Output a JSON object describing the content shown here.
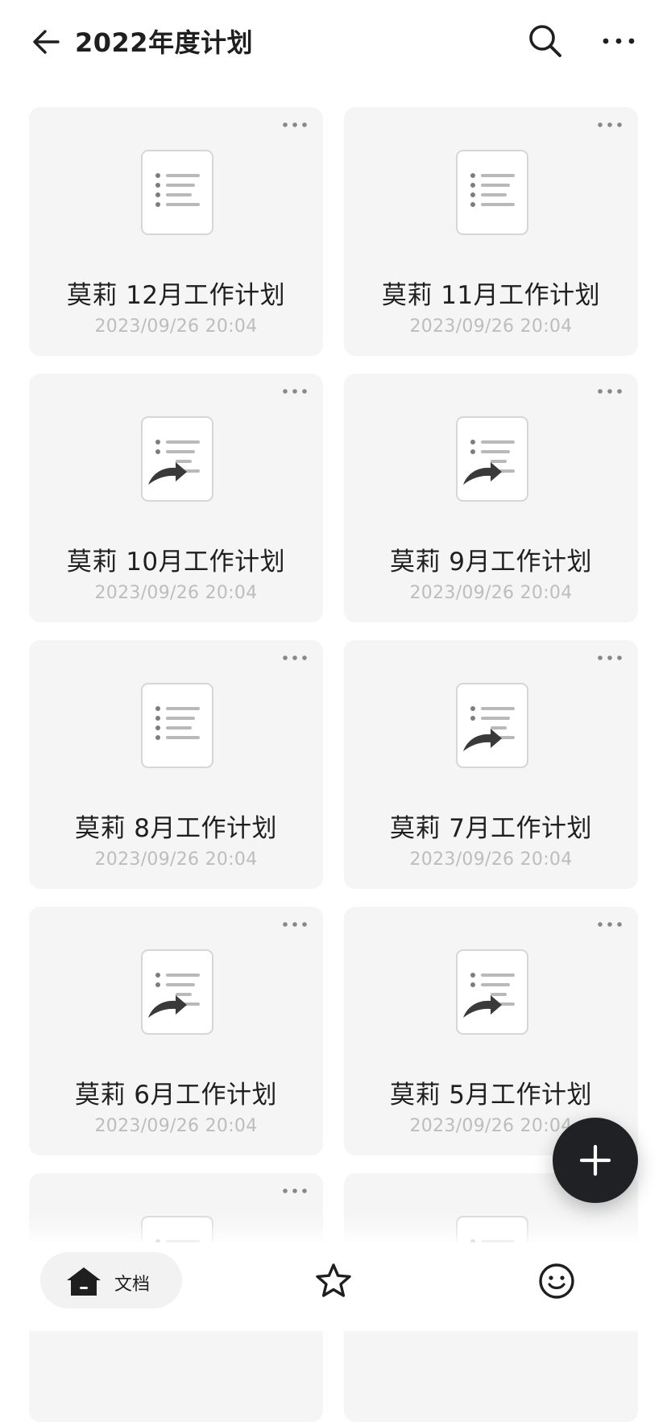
{
  "header": {
    "title": "2022年度计划",
    "back_icon": "arrow-left-icon",
    "search_icon": "search-icon",
    "more_icon": "more-horizontal-icon"
  },
  "cards": [
    {
      "title": "莫莉 12月工作计划",
      "time": "2023/09/26 20:04",
      "icon": "document-icon"
    },
    {
      "title": "莫莉 11月工作计划",
      "time": "2023/09/26 20:04",
      "icon": "document-icon"
    },
    {
      "title": "莫莉 10月工作计划",
      "time": "2023/09/26 20:04",
      "icon": "shared-document-icon"
    },
    {
      "title": "莫莉 9月工作计划",
      "time": "2023/09/26 20:04",
      "icon": "shared-document-icon"
    },
    {
      "title": "莫莉 8月工作计划",
      "time": "2023/09/26 20:04",
      "icon": "document-icon"
    },
    {
      "title": "莫莉 7月工作计划",
      "time": "2023/09/26 20:04",
      "icon": "shared-document-icon"
    },
    {
      "title": "莫莉 6月工作计划",
      "time": "2023/09/26 20:04",
      "icon": "shared-document-icon"
    },
    {
      "title": "莫莉 5月工作计划",
      "time": "2023/09/26 20:04",
      "icon": "shared-document-icon"
    },
    {
      "title": "",
      "time": "",
      "icon": "document-icon"
    },
    {
      "title": "",
      "time": "",
      "icon": "document-icon"
    }
  ],
  "fab": {
    "icon": "plus-icon"
  },
  "bottom_bar": {
    "docs_label": "文档",
    "docs_icon": "home-icon",
    "favorites_icon": "star-icon",
    "profile_icon": "smiley-face-icon"
  },
  "colors": {
    "card_bg": "#f5f5f5",
    "text": "#1f1f1f",
    "timestamp": "#bdbdbd",
    "fab_bg": "#1f2124"
  }
}
